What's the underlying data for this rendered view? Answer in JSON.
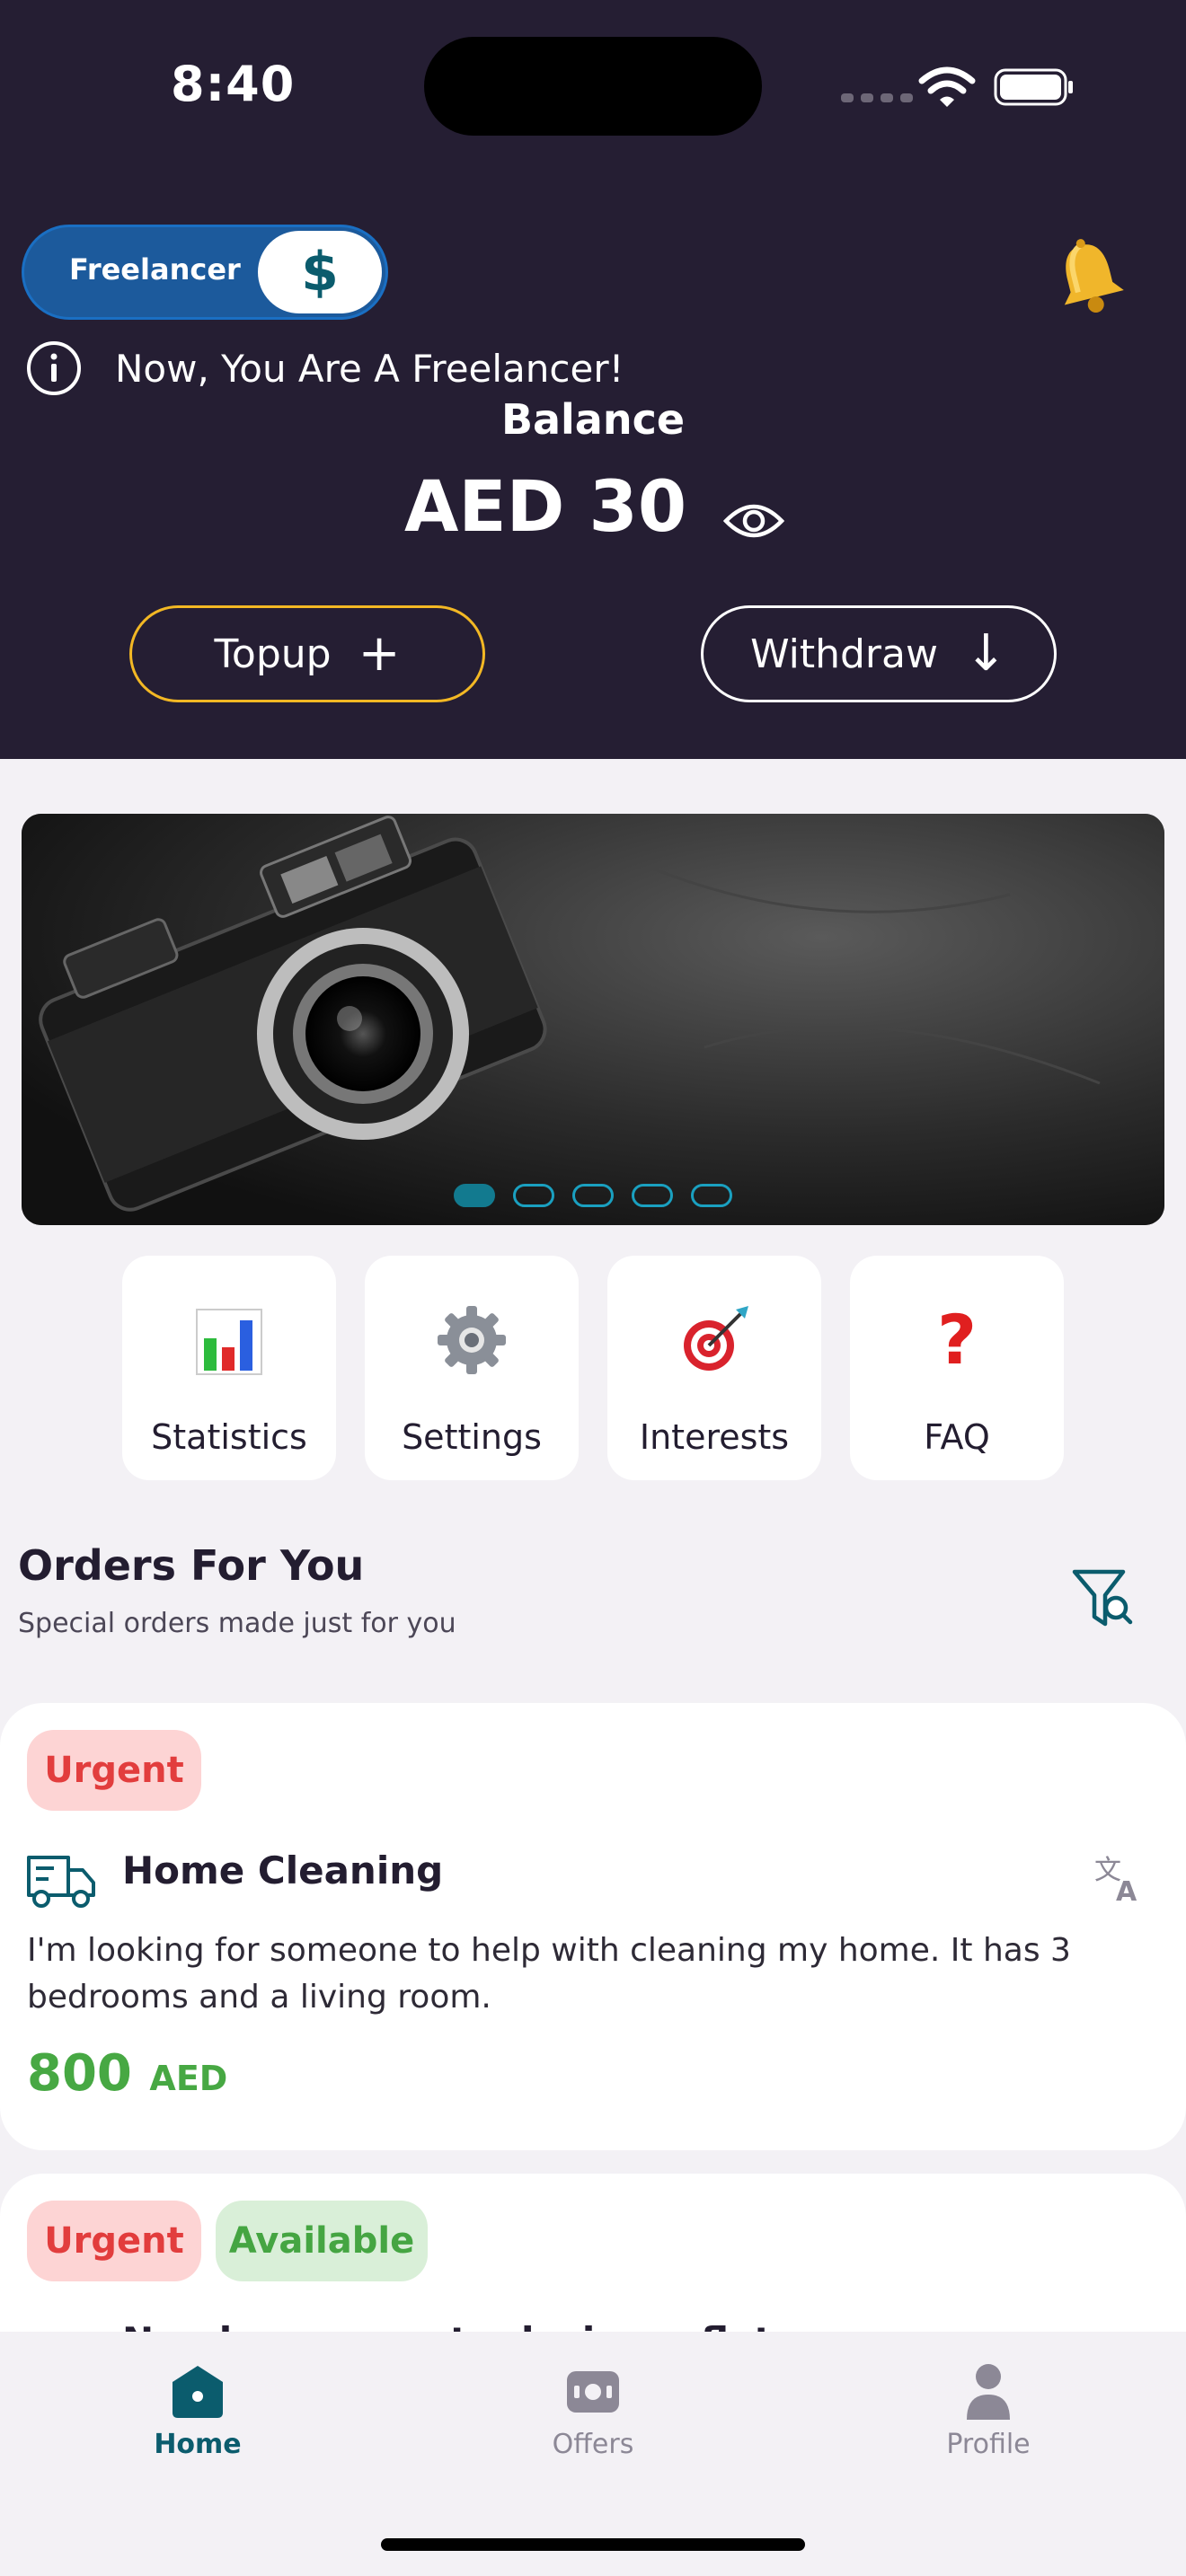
{
  "status_bar": {
    "time": "8:40"
  },
  "header": {
    "mode_toggle": {
      "label": "Freelancer",
      "knob_symbol": "$"
    },
    "notification_icon": "bell-icon",
    "info_message": "Now, You Are A Freelancer!",
    "balance_label": "Balance",
    "balance_value": "AED 30",
    "topup_label": "Topup",
    "topup_symbol": "+",
    "withdraw_label": "Withdraw",
    "withdraw_symbol": "↓"
  },
  "banner": {
    "slides": 5,
    "active_slide": 1
  },
  "quick_actions": [
    {
      "label": "Statistics",
      "icon": "bar-chart-icon"
    },
    {
      "label": "Settings",
      "icon": "gear-icon"
    },
    {
      "label": "Interests",
      "icon": "target-icon"
    },
    {
      "label": "FAQ",
      "icon": "question-icon",
      "glyph": "?"
    }
  ],
  "orders": {
    "title": "Orders For You",
    "subtitle": "Special orders made just for you"
  },
  "cards": [
    {
      "badges": [
        "Urgent"
      ],
      "title": "Home Cleaning",
      "description": "I'm looking for someone to help with cleaning my home. It has 3 bedrooms and a living room.",
      "price": "800",
      "currency": "AED"
    },
    {
      "badges": [
        "Urgent",
        "Available"
      ],
      "title_partial": "Need someone to design a flat ..."
    }
  ],
  "bottom_nav": [
    {
      "label": "Home",
      "active": true
    },
    {
      "label": "Offers",
      "active": false
    },
    {
      "label": "Profile",
      "active": false
    }
  ],
  "colors": {
    "header_bg": "#251e33",
    "accent_teal": "#0b5c6d",
    "urgent": "#e23d3d",
    "available": "#45a542",
    "topup_border": "#f3b824"
  }
}
